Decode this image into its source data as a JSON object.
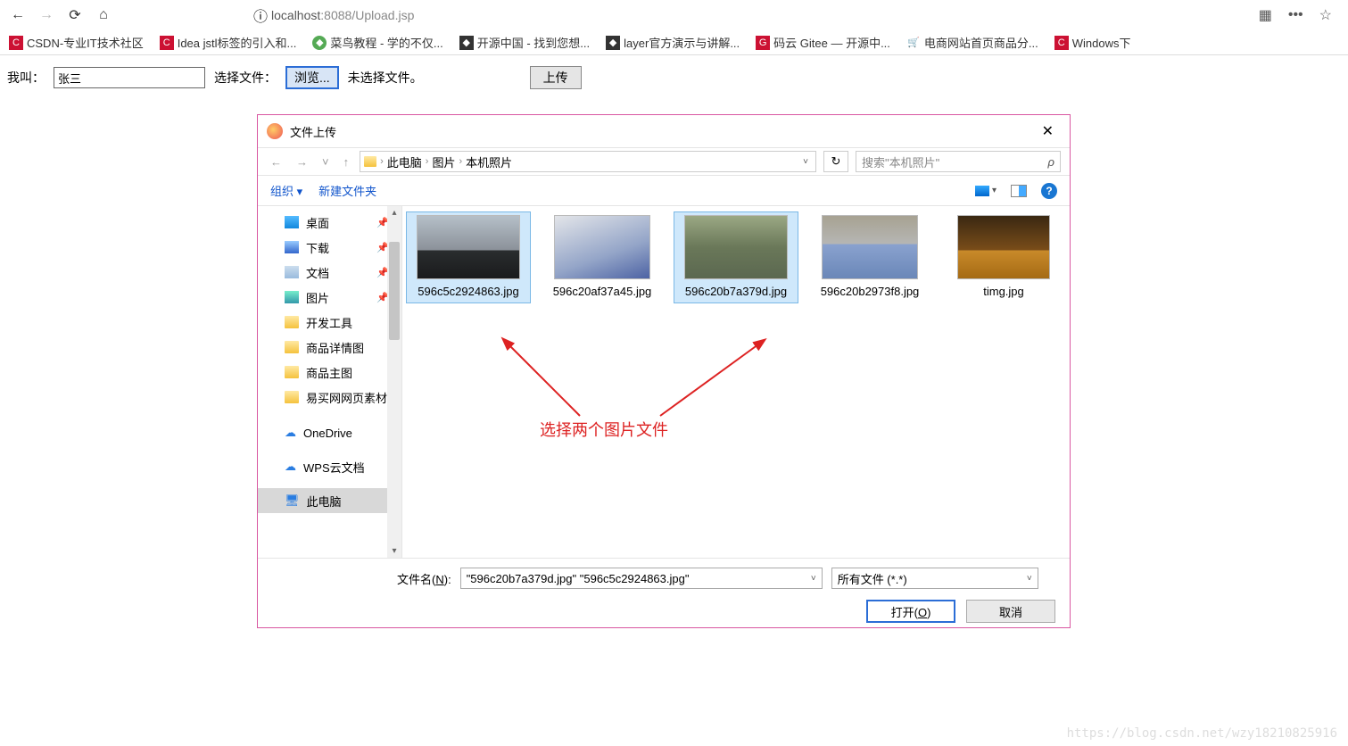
{
  "browser": {
    "url_prefix": "localhost",
    "url_port_path": ":8088/Upload.jsp"
  },
  "bookmarks": [
    {
      "label": "CSDN-专业IT技术社区",
      "icon": "red"
    },
    {
      "label": "Idea jstl标签的引入和...",
      "icon": "red"
    },
    {
      "label": "菜鸟教程 - 学的不仅...",
      "icon": "green"
    },
    {
      "label": "开源中国 - 找到您想...",
      "icon": "dark"
    },
    {
      "label": "layer官方演示与讲解...",
      "icon": "dark"
    },
    {
      "label": "码云 Gitee — 开源中...",
      "icon": "gitee"
    },
    {
      "label": "电商网站首页商品分...",
      "icon": "shop"
    },
    {
      "label": "Windows下",
      "icon": "red"
    }
  ],
  "page": {
    "name_label": "我叫：",
    "name_value": "张三",
    "choose_label": "选择文件：",
    "browse_label": "浏览...",
    "no_file": "未选择文件。",
    "upload_label": "上传"
  },
  "dialog": {
    "title": "文件上传",
    "path": {
      "root": "此电脑",
      "p1": "图片",
      "p2": "本机照片"
    },
    "search_placeholder": "搜索\"本机照片\"",
    "organize": "组织 ▾",
    "new_folder": "新建文件夹",
    "sidebar": [
      {
        "label": "桌面",
        "pin": true,
        "cls": "desk-i"
      },
      {
        "label": "下载",
        "pin": true,
        "cls": "dl-i"
      },
      {
        "label": "文档",
        "pin": true,
        "cls": "doc-i"
      },
      {
        "label": "图片",
        "pin": true,
        "cls": "pic-i"
      },
      {
        "label": "开发工具",
        "pin": false,
        "cls": "folder-y"
      },
      {
        "label": "商品详情图",
        "pin": false,
        "cls": "folder-y"
      },
      {
        "label": "商品主图",
        "pin": false,
        "cls": "folder-y"
      },
      {
        "label": "易买网网页素材",
        "pin": false,
        "cls": "folder-y"
      }
    ],
    "onedrive": "OneDrive",
    "wps": "WPS云文档",
    "thispc": "此电脑",
    "files": [
      {
        "name": "596c5c2924863.jpg",
        "selected": true,
        "t": "t1"
      },
      {
        "name": "596c20af37a45.jpg",
        "selected": false,
        "t": "t2"
      },
      {
        "name": "596c20b7a379d.jpg",
        "selected": true,
        "t": "t3"
      },
      {
        "name": "596c20b2973f8.jpg",
        "selected": false,
        "t": "t4"
      },
      {
        "name": "timg.jpg",
        "selected": false,
        "t": "t5"
      }
    ],
    "annotation": "选择两个图片文件",
    "filename_label_pre": "文件名(",
    "filename_label_u": "N",
    "filename_label_post": "):",
    "filename_value": "\"596c20b7a379d.jpg\" \"596c5c2924863.jpg\"",
    "filter": "所有文件 (*.*)",
    "open_pre": "打开(",
    "open_u": "O",
    "open_post": ")",
    "cancel": "取消"
  },
  "watermark": "https://blog.csdn.net/wzy18210825916"
}
